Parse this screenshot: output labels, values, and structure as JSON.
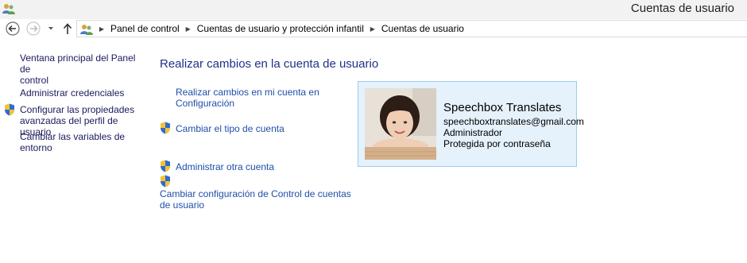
{
  "window": {
    "title": "Cuentas de usuario",
    "app_icon": "user-accounts-icon"
  },
  "navigation": {
    "back_icon": "back-arrow-icon",
    "forward_icon": "forward-arrow-icon",
    "history_icon": "chevron-down-icon",
    "up_icon": "up-arrow-icon",
    "address_icon": "control-panel-icon",
    "breadcrumbs": [
      "Panel de control",
      "Cuentas de usuario y protección infantil",
      "Cuentas de usuario"
    ]
  },
  "sidebar": {
    "items": [
      {
        "label_line1": "Ventana principal del Panel de",
        "label_line2": "control",
        "shield": false
      },
      {
        "label_line1": "Administrar credenciales",
        "label_line2": "",
        "shield": false
      },
      {
        "label_line1": "Configurar las propiedades",
        "label_line2": "avanzadas del perfil de usuario",
        "shield": true
      },
      {
        "label_line1": "Cambiar las variables de",
        "label_line2": "entorno",
        "shield": false
      }
    ]
  },
  "main": {
    "heading": "Realizar cambios en la cuenta de usuario",
    "tasks": [
      {
        "label_line1": "Realizar cambios en mi cuenta en",
        "label_line2": "Configuración",
        "shield": false
      },
      {
        "label_line1": "Cambiar el tipo de cuenta",
        "label_line2": "",
        "shield": true
      },
      {
        "label_line1": "Administrar otra cuenta",
        "label_line2": "",
        "shield": true
      },
      {
        "label_line1": "Cambiar configuración de Control de cuentas",
        "label_line2": "de usuario",
        "shield": true
      }
    ]
  },
  "account": {
    "name": "Speechbox Translates",
    "email": "speechboxtranslates@gmail.com",
    "role": "Administrador",
    "protection": "Protegida por contraseña"
  },
  "colors": {
    "link": "#1e4fa8",
    "heading": "#1e3287",
    "card_background": "#e5f1fb",
    "card_border": "#9ccbee"
  }
}
